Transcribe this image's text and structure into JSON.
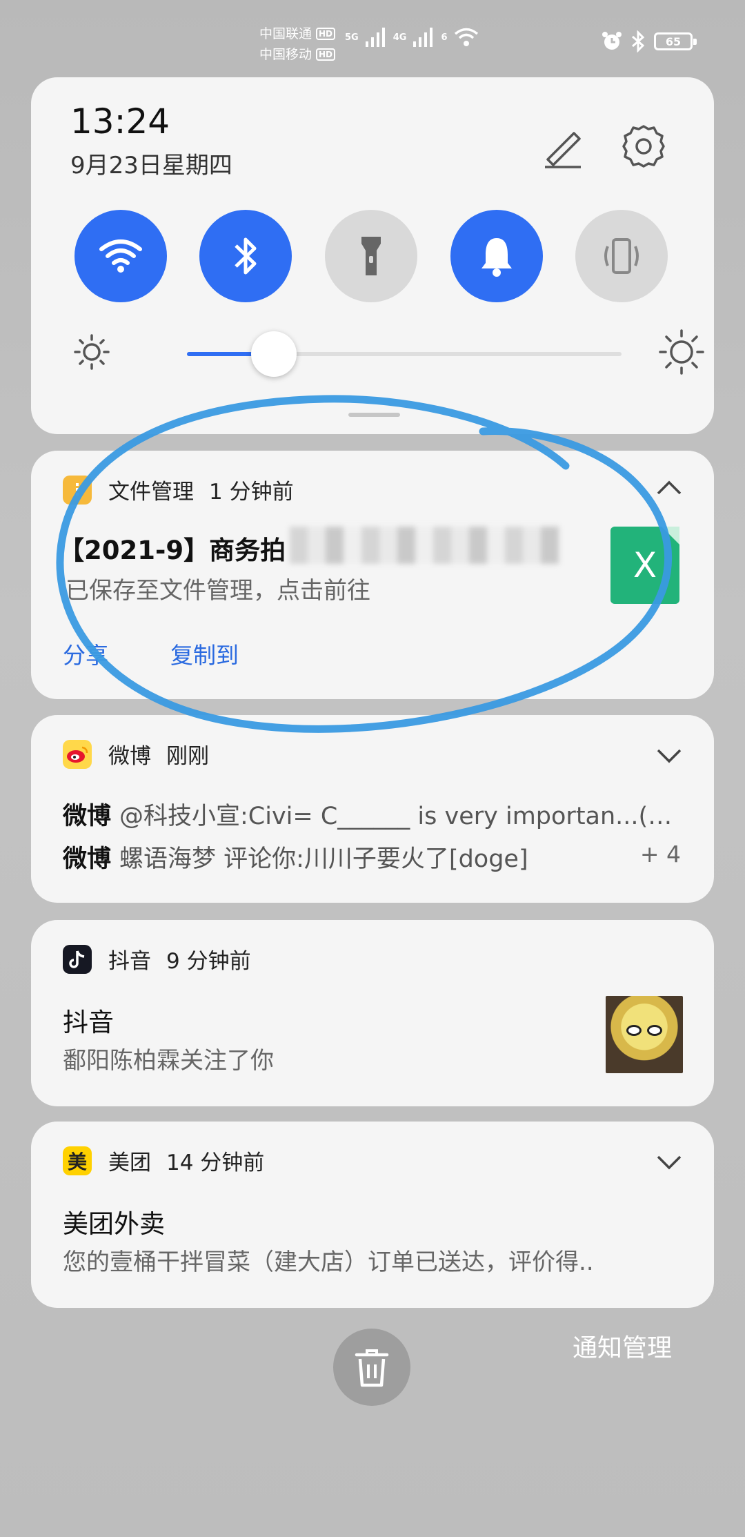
{
  "status_bar": {
    "carrier1": "中国联通",
    "carrier2": "中国移动",
    "hd": "HD",
    "net1": "5G",
    "net2": "4G",
    "wifi_gen": "6",
    "battery": "65"
  },
  "quick_settings": {
    "time": "13:24",
    "date": "9月23日星期四",
    "accent_color": "#2f6ef3",
    "toggles": [
      {
        "name": "wifi",
        "state": "on"
      },
      {
        "name": "bluetooth",
        "state": "on"
      },
      {
        "name": "flashlight",
        "state": "off"
      },
      {
        "name": "sound",
        "state": "on"
      },
      {
        "name": "vibrate",
        "state": "off"
      }
    ],
    "brightness_level": 0.2
  },
  "notifications": {
    "files": {
      "app": "文件管理",
      "time": "1 分钟前",
      "title": "【2021-9】商务拍",
      "text": "已保存至文件管理，点击前往",
      "file_icon": "X",
      "actions": [
        "分享",
        "复制到"
      ]
    },
    "weibo": {
      "app": "微博",
      "time": "刚刚",
      "line1_sender": "微博",
      "line1_text": "@科技小宣:Civi= C______ is very importan...(…",
      "line2_sender": "微博",
      "line2_text": "螺语海梦 评论你:川川子要火了[doge]",
      "more": "+ 4"
    },
    "douyin": {
      "app": "抖音",
      "time": "9 分钟前",
      "title": "抖音",
      "text": "鄱阳陈柏霖关注了你"
    },
    "meituan": {
      "app": "美团",
      "icon_text": "美",
      "time": "14 分钟前",
      "title": "美团外卖",
      "text": "您的壹桶干拌冒菜（建大店）订单已送达，评价得.."
    }
  },
  "footer": {
    "manage": "通知管理"
  }
}
